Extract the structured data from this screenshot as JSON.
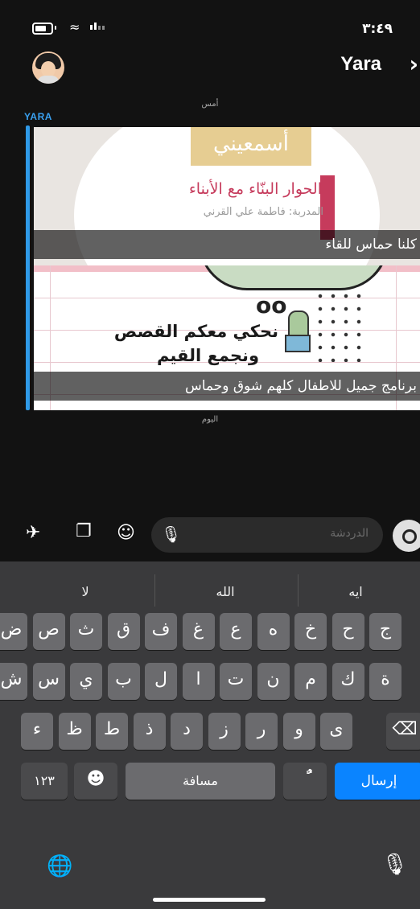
{
  "status": {
    "time": "٣:٤٩"
  },
  "header": {
    "name": "Yara",
    "back": "›"
  },
  "chat": {
    "date_yesterday": "أمس",
    "sender": "YARA",
    "snap1": {
      "title": "أسمعيني",
      "subtitle": "الحوار البنّاء مع الأبناء",
      "trainer": "المدربة: فاطمة علي القرني",
      "caption": "كلنا حماس للقاء"
    },
    "snap2": {
      "line1": "نحكي معكم القصص",
      "line2": "ونجمع القيم",
      "caption": "برنامج جميل للاطفال كلهم شوق وحماس"
    },
    "date_today": "اليوم"
  },
  "composer": {
    "placeholder": "الدردشة"
  },
  "keyboard": {
    "suggestions": [
      "لا",
      "الله",
      "ايه"
    ],
    "row1": [
      "ض",
      "ص",
      "ث",
      "ق",
      "ف",
      "غ",
      "ع",
      "ه",
      "خ",
      "ح",
      "ج"
    ],
    "row2": [
      "ش",
      "س",
      "ي",
      "ب",
      "ل",
      "ا",
      "ت",
      "ن",
      "م",
      "ك",
      "ة"
    ],
    "row3": [
      "ء",
      "ظ",
      "ط",
      "ذ",
      "د",
      "ز",
      "ر",
      "و",
      "ى"
    ],
    "numbers": "١٢٣",
    "space": "مسافة",
    "diacritic": "ًٌ",
    "send": "إرسال"
  },
  "colors": {
    "accent": "#2f9ae8",
    "send": "#0a84ff"
  }
}
